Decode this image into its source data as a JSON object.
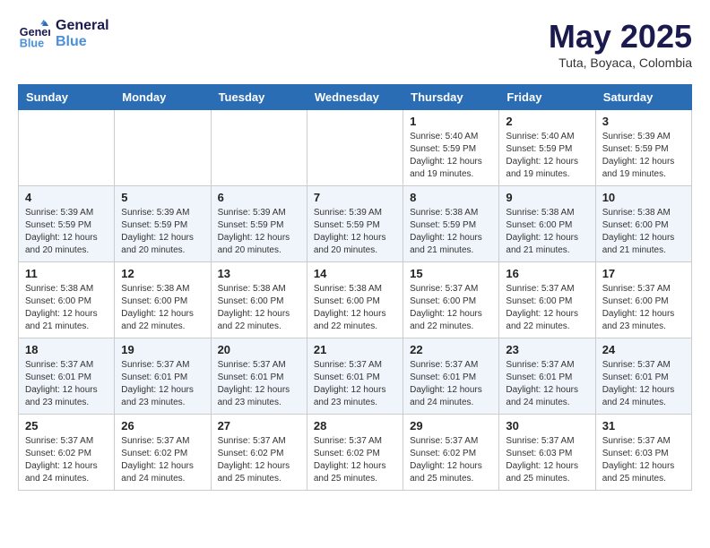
{
  "header": {
    "logo_line1": "General",
    "logo_line2": "Blue",
    "month": "May 2025",
    "location": "Tuta, Boyaca, Colombia"
  },
  "weekdays": [
    "Sunday",
    "Monday",
    "Tuesday",
    "Wednesday",
    "Thursday",
    "Friday",
    "Saturday"
  ],
  "weeks": [
    [
      {
        "day": "",
        "info": ""
      },
      {
        "day": "",
        "info": ""
      },
      {
        "day": "",
        "info": ""
      },
      {
        "day": "",
        "info": ""
      },
      {
        "day": "1",
        "info": "Sunrise: 5:40 AM\nSunset: 5:59 PM\nDaylight: 12 hours\nand 19 minutes."
      },
      {
        "day": "2",
        "info": "Sunrise: 5:40 AM\nSunset: 5:59 PM\nDaylight: 12 hours\nand 19 minutes."
      },
      {
        "day": "3",
        "info": "Sunrise: 5:39 AM\nSunset: 5:59 PM\nDaylight: 12 hours\nand 19 minutes."
      }
    ],
    [
      {
        "day": "4",
        "info": "Sunrise: 5:39 AM\nSunset: 5:59 PM\nDaylight: 12 hours\nand 20 minutes."
      },
      {
        "day": "5",
        "info": "Sunrise: 5:39 AM\nSunset: 5:59 PM\nDaylight: 12 hours\nand 20 minutes."
      },
      {
        "day": "6",
        "info": "Sunrise: 5:39 AM\nSunset: 5:59 PM\nDaylight: 12 hours\nand 20 minutes."
      },
      {
        "day": "7",
        "info": "Sunrise: 5:39 AM\nSunset: 5:59 PM\nDaylight: 12 hours\nand 20 minutes."
      },
      {
        "day": "8",
        "info": "Sunrise: 5:38 AM\nSunset: 5:59 PM\nDaylight: 12 hours\nand 21 minutes."
      },
      {
        "day": "9",
        "info": "Sunrise: 5:38 AM\nSunset: 6:00 PM\nDaylight: 12 hours\nand 21 minutes."
      },
      {
        "day": "10",
        "info": "Sunrise: 5:38 AM\nSunset: 6:00 PM\nDaylight: 12 hours\nand 21 minutes."
      }
    ],
    [
      {
        "day": "11",
        "info": "Sunrise: 5:38 AM\nSunset: 6:00 PM\nDaylight: 12 hours\nand 21 minutes."
      },
      {
        "day": "12",
        "info": "Sunrise: 5:38 AM\nSunset: 6:00 PM\nDaylight: 12 hours\nand 22 minutes."
      },
      {
        "day": "13",
        "info": "Sunrise: 5:38 AM\nSunset: 6:00 PM\nDaylight: 12 hours\nand 22 minutes."
      },
      {
        "day": "14",
        "info": "Sunrise: 5:38 AM\nSunset: 6:00 PM\nDaylight: 12 hours\nand 22 minutes."
      },
      {
        "day": "15",
        "info": "Sunrise: 5:37 AM\nSunset: 6:00 PM\nDaylight: 12 hours\nand 22 minutes."
      },
      {
        "day": "16",
        "info": "Sunrise: 5:37 AM\nSunset: 6:00 PM\nDaylight: 12 hours\nand 22 minutes."
      },
      {
        "day": "17",
        "info": "Sunrise: 5:37 AM\nSunset: 6:00 PM\nDaylight: 12 hours\nand 23 minutes."
      }
    ],
    [
      {
        "day": "18",
        "info": "Sunrise: 5:37 AM\nSunset: 6:01 PM\nDaylight: 12 hours\nand 23 minutes."
      },
      {
        "day": "19",
        "info": "Sunrise: 5:37 AM\nSunset: 6:01 PM\nDaylight: 12 hours\nand 23 minutes."
      },
      {
        "day": "20",
        "info": "Sunrise: 5:37 AM\nSunset: 6:01 PM\nDaylight: 12 hours\nand 23 minutes."
      },
      {
        "day": "21",
        "info": "Sunrise: 5:37 AM\nSunset: 6:01 PM\nDaylight: 12 hours\nand 23 minutes."
      },
      {
        "day": "22",
        "info": "Sunrise: 5:37 AM\nSunset: 6:01 PM\nDaylight: 12 hours\nand 24 minutes."
      },
      {
        "day": "23",
        "info": "Sunrise: 5:37 AM\nSunset: 6:01 PM\nDaylight: 12 hours\nand 24 minutes."
      },
      {
        "day": "24",
        "info": "Sunrise: 5:37 AM\nSunset: 6:01 PM\nDaylight: 12 hours\nand 24 minutes."
      }
    ],
    [
      {
        "day": "25",
        "info": "Sunrise: 5:37 AM\nSunset: 6:02 PM\nDaylight: 12 hours\nand 24 minutes."
      },
      {
        "day": "26",
        "info": "Sunrise: 5:37 AM\nSunset: 6:02 PM\nDaylight: 12 hours\nand 24 minutes."
      },
      {
        "day": "27",
        "info": "Sunrise: 5:37 AM\nSunset: 6:02 PM\nDaylight: 12 hours\nand 25 minutes."
      },
      {
        "day": "28",
        "info": "Sunrise: 5:37 AM\nSunset: 6:02 PM\nDaylight: 12 hours\nand 25 minutes."
      },
      {
        "day": "29",
        "info": "Sunrise: 5:37 AM\nSunset: 6:02 PM\nDaylight: 12 hours\nand 25 minutes."
      },
      {
        "day": "30",
        "info": "Sunrise: 5:37 AM\nSunset: 6:03 PM\nDaylight: 12 hours\nand 25 minutes."
      },
      {
        "day": "31",
        "info": "Sunrise: 5:37 AM\nSunset: 6:03 PM\nDaylight: 12 hours\nand 25 minutes."
      }
    ]
  ]
}
